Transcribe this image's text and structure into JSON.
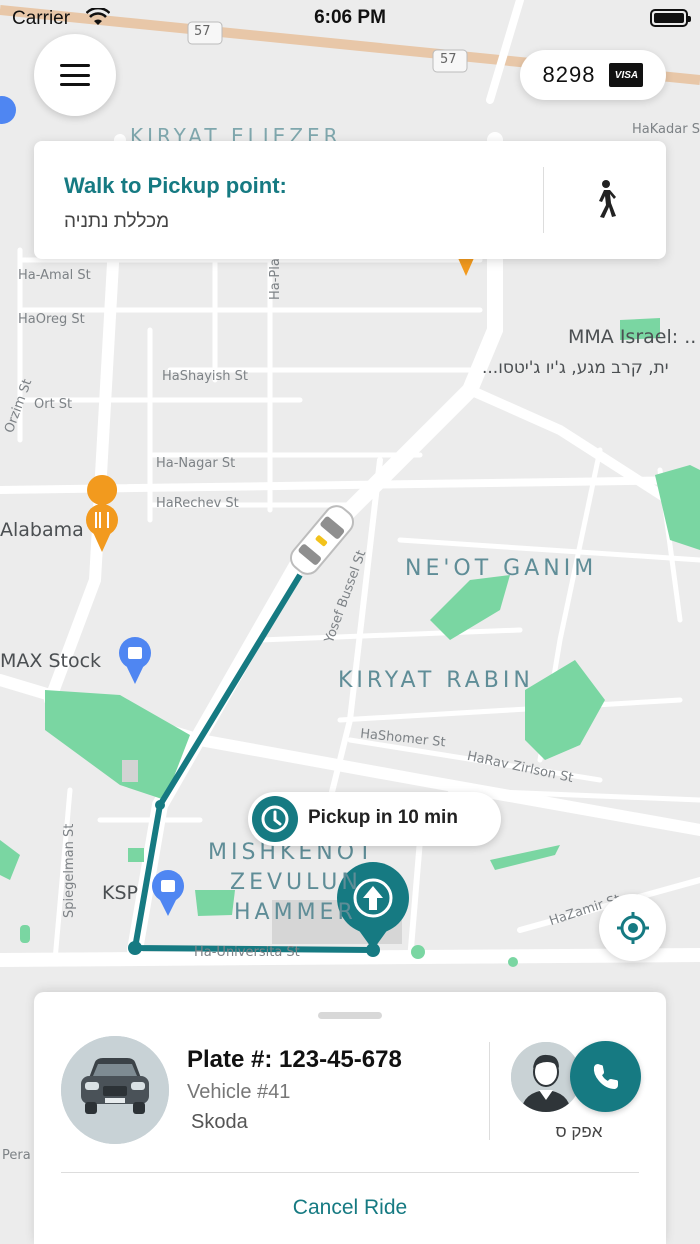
{
  "status_bar": {
    "carrier": "Carrier",
    "time": "6:06 PM"
  },
  "payment": {
    "digits": "8298",
    "card_brand": "VISA"
  },
  "walk_card": {
    "title": "Walk to Pickup point:",
    "subtitle": "מכללת נתניה"
  },
  "pickup": {
    "text": "Pickup in 10 min"
  },
  "map": {
    "streets": [
      "KIRYAT ELIEZER",
      "HaKadar St",
      "Ha-Amal St",
      "HaOreg St",
      "Ha-Plada St",
      "HaShayish St",
      "Ort St",
      "Ha-Nagar St",
      "HaRechev St",
      "Yosef Bussel St",
      "HaShomer St",
      "HaRav Zirlson St",
      "Spiegelman St",
      "Ha-Universita St",
      "HaZamir St",
      "Orzim St",
      "Pera"
    ],
    "neighborhoods": [
      "NE'OT GANIM",
      "KIRYAT RABIN",
      "MISHKENOT",
      "ZEVULUN",
      "HAMMER"
    ],
    "pois": [
      "MMA Israel: ..",
      "...ית, קרב מגע, ג'יו ג'יטסו",
      "Alabama",
      "MAX Stock",
      "KSP"
    ],
    "route_numbers": [
      "57",
      "57"
    ],
    "colors": {
      "route": "#167a82",
      "park": "#7ad6a2",
      "accent": "#167a82"
    }
  },
  "ride": {
    "plate": "Plate #: 123-45-678",
    "vehicle": "Vehicle #41",
    "make": "Skoda",
    "driver_name": "אפק ס",
    "cancel_label": "Cancel Ride"
  }
}
